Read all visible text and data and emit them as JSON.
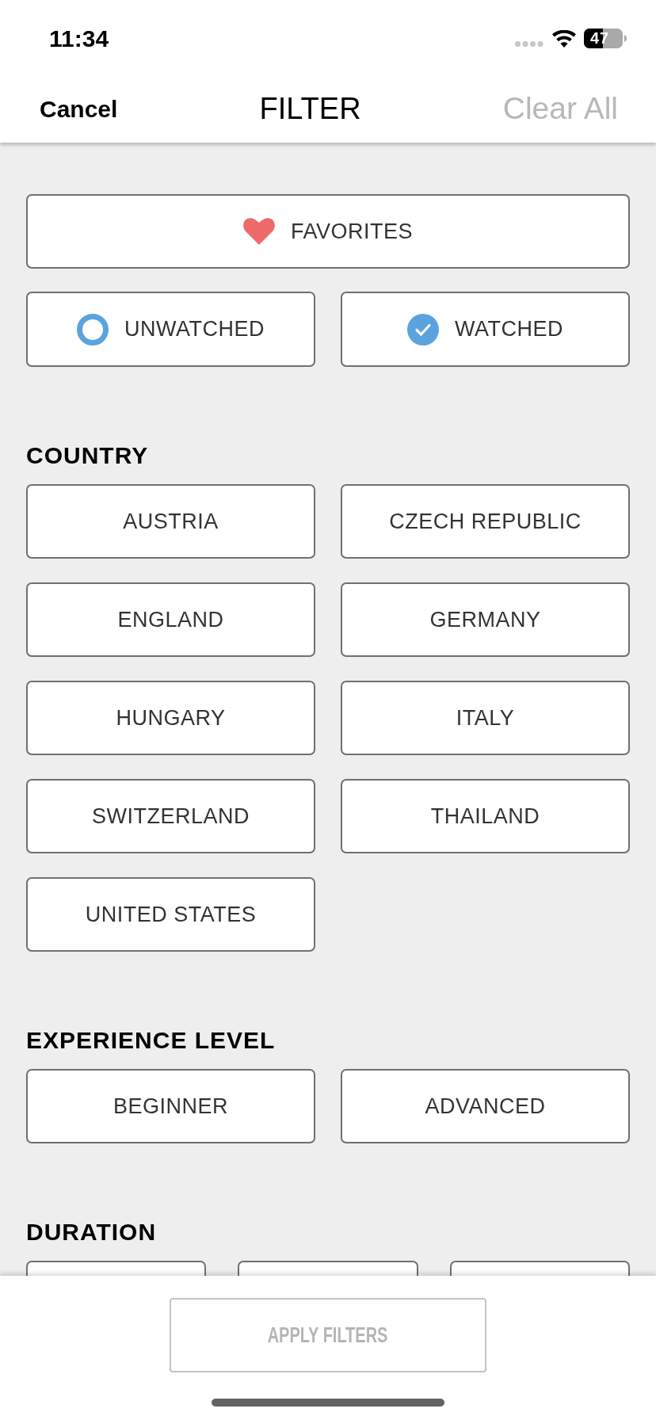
{
  "status_bar": {
    "time": "11:34",
    "battery": "47"
  },
  "nav": {
    "cancel": "Cancel",
    "title": "FILTER",
    "clear_all": {
      "label": "Clear All",
      "disabled": true
    }
  },
  "quick_filters": {
    "favorites": {
      "label": "FAVORITES",
      "selected": false
    },
    "watch_status": [
      {
        "label": "UNWATCHED",
        "checked": false
      },
      {
        "label": "WATCHED",
        "checked": true
      }
    ]
  },
  "sections": [
    {
      "kind": "grid2",
      "heading": "COUNTRY",
      "options": [
        {
          "label": "AUSTRIA",
          "selected": false
        },
        {
          "label": "CZECH REPUBLIC",
          "selected": false
        },
        {
          "label": "ENGLAND",
          "selected": false
        },
        {
          "label": "GERMANY",
          "selected": false
        },
        {
          "label": "HUNGARY",
          "selected": false
        },
        {
          "label": "ITALY",
          "selected": false
        },
        {
          "label": "SWITZERLAND",
          "selected": false
        },
        {
          "label": "THAILAND",
          "selected": false
        },
        {
          "label": "UNITED STATES",
          "selected": false
        }
      ]
    },
    {
      "kind": "grid2",
      "heading": "EXPERIENCE LEVEL",
      "options": [
        {
          "label": "BEGINNER",
          "selected": false
        },
        {
          "label": "ADVANCED",
          "selected": false
        }
      ]
    },
    {
      "kind": "grid3",
      "heading": "DURATION",
      "options": [
        {
          "selected": false
        },
        {
          "selected": false
        },
        {
          "selected": false
        }
      ]
    }
  ],
  "apply_button": {
    "label": "APPLY FILTERS",
    "disabled": true
  }
}
